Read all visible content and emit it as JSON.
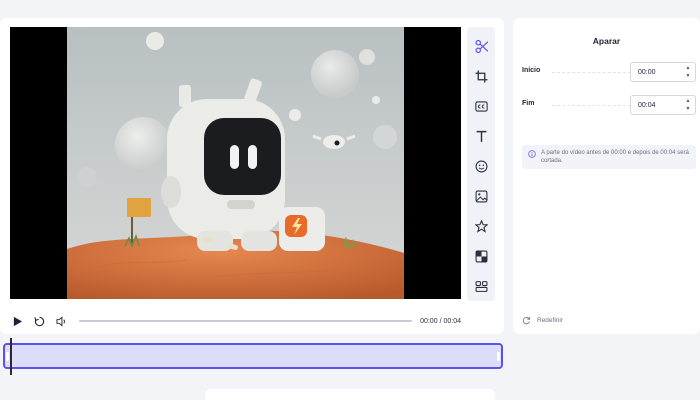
{
  "player": {
    "current_time": "00:00",
    "duration": "00:04",
    "time_separator": "/",
    "progress": 0
  },
  "tools": [
    {
      "name": "scissors-icon",
      "active": true
    },
    {
      "name": "crop-icon",
      "active": false
    },
    {
      "name": "captions-icon",
      "active": false
    },
    {
      "name": "text-icon",
      "active": false
    },
    {
      "name": "emoji-icon",
      "active": false
    },
    {
      "name": "image-icon",
      "active": false
    },
    {
      "name": "star-icon",
      "active": false
    },
    {
      "name": "filter-icon",
      "active": false
    },
    {
      "name": "layout-icon",
      "active": false
    }
  ],
  "panel": {
    "title": "Aparar",
    "start_label": "Início",
    "start_value": "00:00",
    "end_label": "Fim",
    "end_value": "00:04",
    "notice": "A parte do vídeo antes de 00:00 e depois de 00:04 será cortada.",
    "reset_label": "Redefinir"
  },
  "colors": {
    "accent": "#5b53f0",
    "timeline_fill": "#dcdcfb",
    "background": "#f3f4f8"
  }
}
